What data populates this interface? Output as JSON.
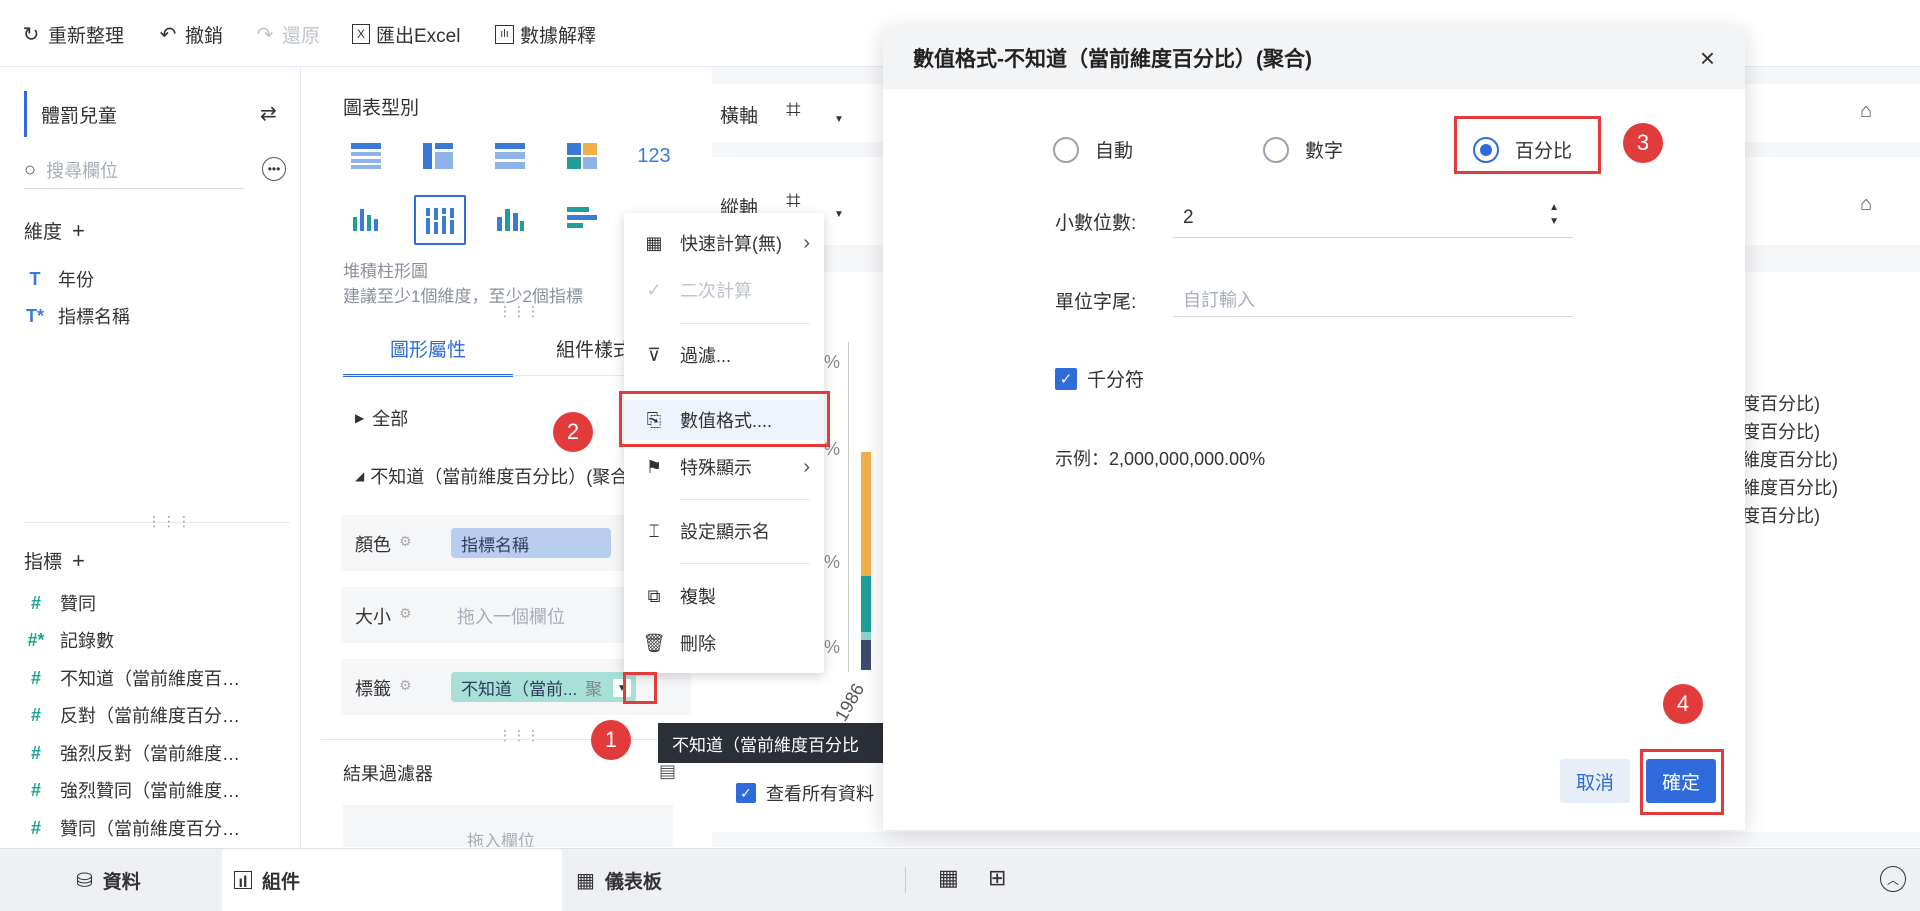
{
  "toolbar": {
    "refresh": "重新整理",
    "undo": "撤銷",
    "redo": "還原",
    "export": "匯出Excel",
    "explain": "數據解釋"
  },
  "left": {
    "dataset": "體罰兒童",
    "search_placeholder": "搜尋欄位",
    "dimension_title": "維度",
    "dimensions": [
      "年份",
      "指標名稱"
    ],
    "measure_title": "指標",
    "measures": [
      "贊同",
      "記錄數",
      "不知道（當前維度百…",
      "反對（當前維度百分…",
      "強烈反對（當前維度…",
      "強烈贊同（當前維度…",
      "贊同（當前維度百分…"
    ]
  },
  "middle": {
    "chart_type_title": "圖表型別",
    "chart_name": "堆積柱形圖",
    "chart_hint": "建議至少1個維度，至少2個指標",
    "tab_active": "圖形屬性",
    "tab_other": "組件樣式",
    "all": "全部",
    "measure_item": "不知道（當前維度百分比）(聚合)",
    "color_label": "顏色",
    "color_pill": "指標名稱",
    "size_label": "大小",
    "size_placeholder": "拖入一個欄位",
    "tag_label": "標籤",
    "tag_pill": "不知道（當前...",
    "tag_pill_suffix": "聚",
    "filter_title": "結果過濾器",
    "filter_placeholder": "拖入欄位"
  },
  "menu": {
    "quick_calc": "快速計算(無)",
    "second_calc": "二次計算",
    "filter": "過濾...",
    "number_format": "數值格式....",
    "special_display": "特殊顯示",
    "rename": "設定顯示名",
    "copy": "複製",
    "delete": "刪除"
  },
  "tooltip": "不知道（當前維度百分比",
  "right": {
    "x_axis": "橫軸",
    "y_axis": "縱軸",
    "pct_ticks": [
      "%",
      "%",
      "%",
      "%"
    ],
    "year_label": "1986",
    "legend": [
      "度百分比)",
      "度百分比)",
      "維度百分比)",
      "維度百分比)",
      "度百分比)"
    ],
    "view_all": "查看所有資料"
  },
  "dialog": {
    "title": "數值格式-不知道（當前維度百分比）(聚合)",
    "opt_auto": "自動",
    "opt_number": "數字",
    "opt_percent": "百分比",
    "decimals_label": "小數位數:",
    "decimals_value": "2",
    "unit_label": "單位字尾:",
    "unit_placeholder": "自訂輸入",
    "thousands": "千分符",
    "example": "示例：2,000,000,000.00%",
    "cancel": "取消",
    "confirm": "確定"
  },
  "badges": [
    "1",
    "2",
    "3",
    "4"
  ],
  "bottom": {
    "data": "資料",
    "component": "組件",
    "dashboard": "儀表板"
  },
  "colors": {
    "accent": "#2f6bda",
    "annotation_red": "#e23b3b",
    "bar_orange": "#f2b04c",
    "bar_teal": "#1f9e9a",
    "bar_navy": "#3e4a6b"
  }
}
